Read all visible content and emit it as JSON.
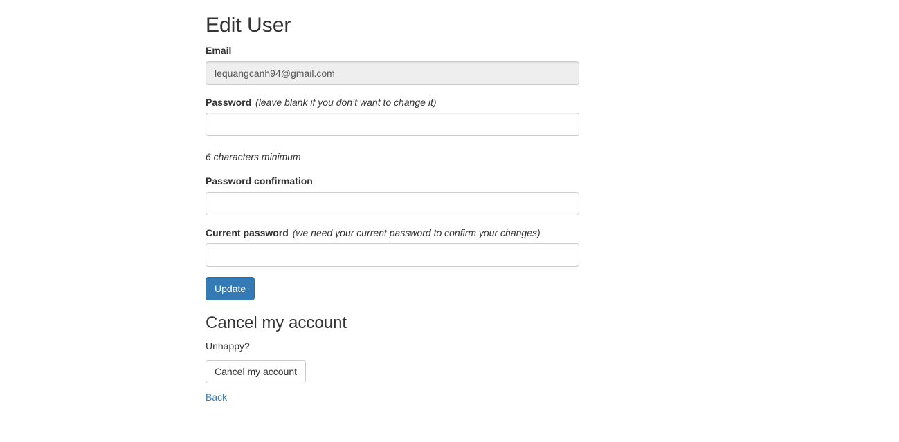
{
  "page": {
    "title": "Edit User"
  },
  "form": {
    "email": {
      "label": "Email",
      "value": "lequangcanh94@gmail.com"
    },
    "password": {
      "label": "Password",
      "hint": "(leave blank if you don’t want to change it)",
      "value": "",
      "help": "6 characters minimum"
    },
    "password_confirmation": {
      "label": "Password confirmation",
      "value": ""
    },
    "current_password": {
      "label": "Current password",
      "hint": "(we need your current password to confirm your changes)",
      "value": ""
    },
    "submit_label": "Update"
  },
  "cancel_section": {
    "title": "Cancel my account",
    "text": "Unhappy?",
    "button_label": "Cancel my account"
  },
  "back_link": "Back",
  "colors": {
    "primary": "#337ab7",
    "link": "#337ab7",
    "text": "#333333",
    "disabled_field": "#eeeeee"
  }
}
